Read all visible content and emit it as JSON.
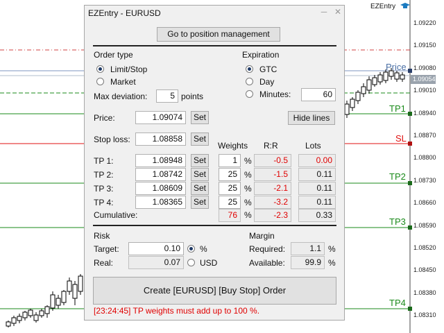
{
  "chart": {
    "brand": "EZEntry",
    "price_ticks": [
      "1.09220",
      "1.09150",
      "1.09080",
      "1.09010",
      "1.08940",
      "1.08870",
      "1.08800",
      "1.08730",
      "1.08660",
      "1.08590",
      "1.08520",
      "1.08450",
      "1.08380",
      "1.08310"
    ],
    "current_price_tag": "1.09054",
    "line_labels": {
      "price": "Price",
      "tp1": "TP1",
      "sl": "SL",
      "tp2": "TP2",
      "tp3": "TP3",
      "tp4": "TP4"
    },
    "colors": {
      "price": "#4a6fa5",
      "tp": "#1a8a1a",
      "sl": "#e01010",
      "dotted_red": "#d04040"
    }
  },
  "window": {
    "title": "EZEntry - EURUSD",
    "minimize": "─",
    "close": "✕"
  },
  "top_button": "Go to position management",
  "order_type": {
    "heading": "Order type",
    "options": [
      "Limit/Stop",
      "Market"
    ],
    "selected": 0
  },
  "max_deviation": {
    "label": "Max deviation:",
    "value": "5",
    "unit": "points"
  },
  "expiration": {
    "heading": "Expiration",
    "options": [
      "GTC",
      "Day",
      "Minutes:"
    ],
    "selected": 0,
    "minutes": "60"
  },
  "price": {
    "label": "Price:",
    "value": "1.09074",
    "set": "Set",
    "hide_lines": "Hide lines"
  },
  "stop_loss": {
    "label": "Stop loss:",
    "value": "1.08858",
    "set": "Set"
  },
  "headers": {
    "weights": "Weights",
    "rr": "R:R",
    "lots": "Lots"
  },
  "tps": [
    {
      "label": "TP 1:",
      "value": "1.08948",
      "set": "Set",
      "weight": "1",
      "pct": "%",
      "rr": "-0.5",
      "lots": "0.00"
    },
    {
      "label": "TP 2:",
      "value": "1.08742",
      "set": "Set",
      "weight": "25",
      "pct": "%",
      "rr": "-1.5",
      "lots": "0.11"
    },
    {
      "label": "TP 3:",
      "value": "1.08609",
      "set": "Set",
      "weight": "25",
      "pct": "%",
      "rr": "-2.1",
      "lots": "0.11"
    },
    {
      "label": "TP 4:",
      "value": "1.08365",
      "set": "Set",
      "weight": "25",
      "pct": "%",
      "rr": "-3.2",
      "lots": "0.11"
    }
  ],
  "cumulative": {
    "label": "Cumulative:",
    "weight": "76",
    "pct": "%",
    "rr": "-2.3",
    "lots": "0.33"
  },
  "risk": {
    "heading": "Risk",
    "target_label": "Target:",
    "target_value": "0.10",
    "real_label": "Real:",
    "real_value": "0.07",
    "unit_options": [
      "%",
      "USD"
    ],
    "unit_selected": 0
  },
  "margin": {
    "heading": "Margin",
    "required_label": "Required:",
    "required_value": "1.1",
    "required_pct": "%",
    "available_label": "Available:",
    "available_value": "99.9",
    "available_pct": "%"
  },
  "create_button": "Create [EURUSD] [Buy Stop] Order",
  "status_message": "[23:24:45] TP weights must add up to 100 %."
}
